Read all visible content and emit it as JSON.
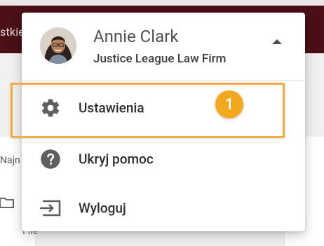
{
  "background": {
    "topbar_partial_text": "stkie",
    "left_partial_label": "Najn",
    "file_label": "File"
  },
  "profile": {
    "name": "Annie Clark",
    "firm": "Justice League Law Firm",
    "avatar_icon": "user-avatar"
  },
  "menu": {
    "items": [
      {
        "label": "Ustawienia",
        "icon": "gear-icon"
      },
      {
        "label": "Ukryj pomoc",
        "icon": "help-icon"
      },
      {
        "label": "Wyloguj",
        "icon": "logout-icon"
      }
    ]
  },
  "overlay": {
    "step_number": "1",
    "accent_color": "#f2a91f"
  }
}
